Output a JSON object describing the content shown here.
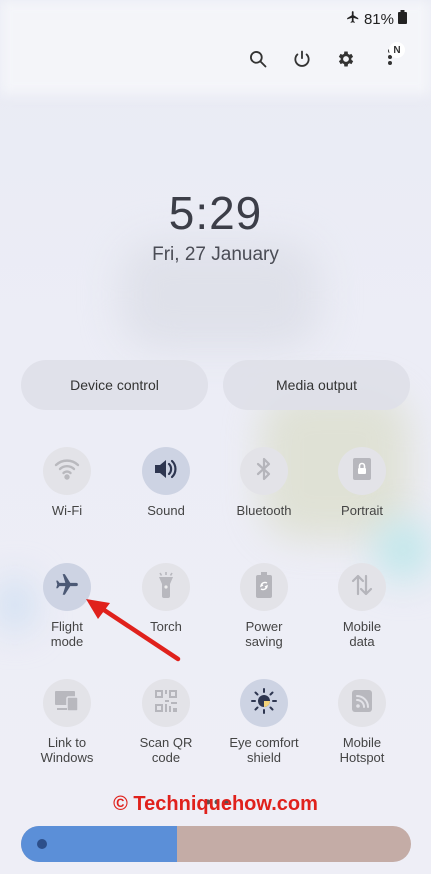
{
  "status_bar": {
    "battery": "81%",
    "airplane_icon": "airplane-icon",
    "battery_icon": "battery-icon"
  },
  "toolbar": {
    "icons": [
      "search-icon",
      "power-icon",
      "gear-icon",
      "more-vert-icon"
    ],
    "badge": "N"
  },
  "clock": {
    "time": "5:29",
    "date": "Fri, 27 January"
  },
  "pills": {
    "device_control": "Device control",
    "media_output": "Media output"
  },
  "tiles": [
    {
      "label": "Wi-Fi",
      "icon": "wifi-icon",
      "active": false
    },
    {
      "label": "Sound",
      "icon": "speaker-icon",
      "active": true
    },
    {
      "label": "Bluetooth",
      "icon": "bluetooth-icon",
      "active": false
    },
    {
      "label": "Portrait",
      "icon": "portrait-lock-icon",
      "active": false
    },
    {
      "label": "Flight\nmode",
      "icon": "airplane-icon",
      "active": true
    },
    {
      "label": "Torch",
      "icon": "flashlight-icon",
      "active": false
    },
    {
      "label": "Power\nsaving",
      "icon": "battery-saver-icon",
      "active": false
    },
    {
      "label": "Mobile\ndata",
      "icon": "data-arrows-icon",
      "active": false
    },
    {
      "label": "Link to\nWindows",
      "icon": "link-windows-icon",
      "active": false
    },
    {
      "label": "Scan QR\ncode",
      "icon": "qr-code-icon",
      "active": false
    },
    {
      "label": "Eye comfort\nshield",
      "icon": "sun-icon",
      "active": true
    },
    {
      "label": "Mobile\nHotspot",
      "icon": "hotspot-icon",
      "active": false
    }
  ],
  "watermark": "© Techniquehow.com",
  "brightness": {
    "level": 0.4
  },
  "colors": {
    "accent": "#5b8fd8",
    "arrow": "#e0211c",
    "watermark": "#e0211c"
  }
}
